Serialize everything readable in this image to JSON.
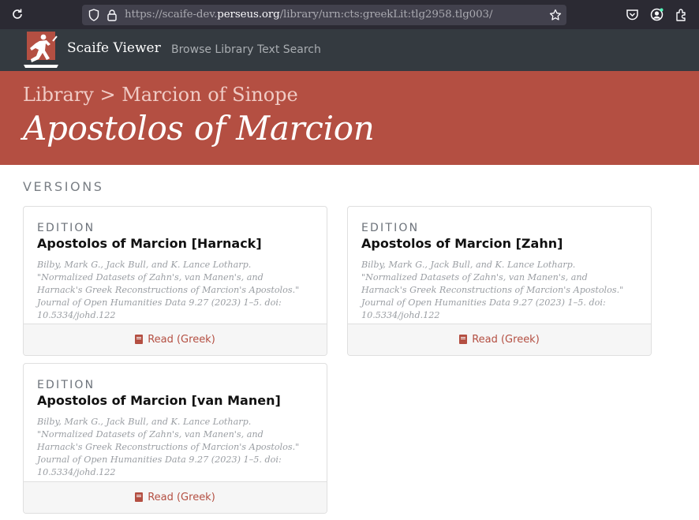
{
  "browser": {
    "url_prefix": "https://scaife-dev.",
    "url_domain": "perseus.org",
    "url_path": "/library/urn:cts:greekLit:tlg2958.tlg003/"
  },
  "nav": {
    "brand": "Scaife Viewer",
    "links": [
      "Browse Library",
      "Text Search"
    ]
  },
  "header": {
    "breadcrumb_root": "Library",
    "breadcrumb_sep": ">",
    "breadcrumb_author": "Marcion of Sinope",
    "title": "Apostolos of Marcion"
  },
  "section_heading": "VERSIONS",
  "versions": [
    {
      "kind": "EDITION",
      "title": "Apostolos of Marcion [Harnack]",
      "citation": "Bilby, Mark G., Jack Bull, and K. Lance Lotharp. \"Normalized Datasets of Zahn's, van Manen's, and Harnack's Greek Reconstructions of Marcion's Apostolos.\" Journal of Open Humanities Data 9.27 (2023) 1–5. doi: 10.5334/johd.122",
      "read_label": "Read (Greek)"
    },
    {
      "kind": "EDITION",
      "title": "Apostolos of Marcion [Zahn]",
      "citation": "Bilby, Mark G., Jack Bull, and K. Lance Lotharp. \"Normalized Datasets of Zahn's, van Manen's, and Harnack's Greek Reconstructions of Marcion's Apostolos.\" Journal of Open Humanities Data 9.27 (2023) 1–5. doi: 10.5334/johd.122",
      "read_label": "Read (Greek)"
    },
    {
      "kind": "EDITION",
      "title": "Apostolos of Marcion [van Manen]",
      "citation": "Bilby, Mark G., Jack Bull, and K. Lance Lotharp. \"Normalized Datasets of Zahn's, van Manen's, and Harnack's Greek Reconstructions of Marcion's Apostolos.\" Journal of Open Humanities Data 9.27 (2023) 1–5. doi: 10.5334/johd.122",
      "read_label": "Read (Greek)"
    }
  ],
  "colors": {
    "accent": "#b44f42",
    "navbar": "#343a40",
    "browser_chrome": "#2b2a33"
  },
  "icons": [
    "reload-icon",
    "shield-icon",
    "lock-icon",
    "star-icon",
    "pocket-icon",
    "account-icon",
    "extensions-icon",
    "book-icon"
  ]
}
